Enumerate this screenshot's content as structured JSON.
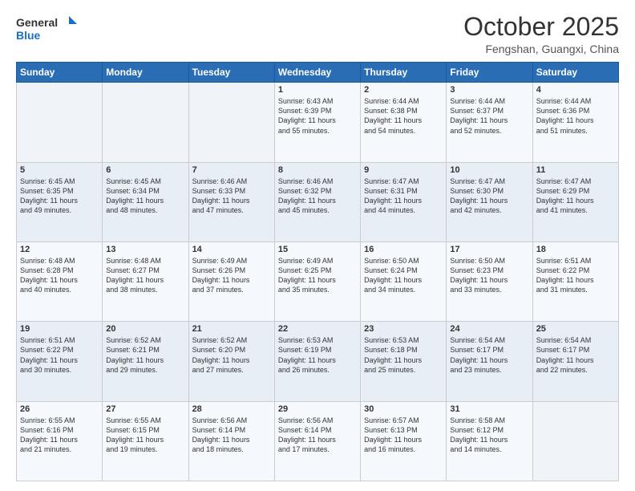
{
  "logo": {
    "line1": "General",
    "line2": "Blue"
  },
  "title": "October 2025",
  "location": "Fengshan, Guangxi, China",
  "weekdays": [
    "Sunday",
    "Monday",
    "Tuesday",
    "Wednesday",
    "Thursday",
    "Friday",
    "Saturday"
  ],
  "weeks": [
    [
      {
        "day": "",
        "info": ""
      },
      {
        "day": "",
        "info": ""
      },
      {
        "day": "",
        "info": ""
      },
      {
        "day": "1",
        "info": "Sunrise: 6:43 AM\nSunset: 6:39 PM\nDaylight: 11 hours\nand 55 minutes."
      },
      {
        "day": "2",
        "info": "Sunrise: 6:44 AM\nSunset: 6:38 PM\nDaylight: 11 hours\nand 54 minutes."
      },
      {
        "day": "3",
        "info": "Sunrise: 6:44 AM\nSunset: 6:37 PM\nDaylight: 11 hours\nand 52 minutes."
      },
      {
        "day": "4",
        "info": "Sunrise: 6:44 AM\nSunset: 6:36 PM\nDaylight: 11 hours\nand 51 minutes."
      }
    ],
    [
      {
        "day": "5",
        "info": "Sunrise: 6:45 AM\nSunset: 6:35 PM\nDaylight: 11 hours\nand 49 minutes."
      },
      {
        "day": "6",
        "info": "Sunrise: 6:45 AM\nSunset: 6:34 PM\nDaylight: 11 hours\nand 48 minutes."
      },
      {
        "day": "7",
        "info": "Sunrise: 6:46 AM\nSunset: 6:33 PM\nDaylight: 11 hours\nand 47 minutes."
      },
      {
        "day": "8",
        "info": "Sunrise: 6:46 AM\nSunset: 6:32 PM\nDaylight: 11 hours\nand 45 minutes."
      },
      {
        "day": "9",
        "info": "Sunrise: 6:47 AM\nSunset: 6:31 PM\nDaylight: 11 hours\nand 44 minutes."
      },
      {
        "day": "10",
        "info": "Sunrise: 6:47 AM\nSunset: 6:30 PM\nDaylight: 11 hours\nand 42 minutes."
      },
      {
        "day": "11",
        "info": "Sunrise: 6:47 AM\nSunset: 6:29 PM\nDaylight: 11 hours\nand 41 minutes."
      }
    ],
    [
      {
        "day": "12",
        "info": "Sunrise: 6:48 AM\nSunset: 6:28 PM\nDaylight: 11 hours\nand 40 minutes."
      },
      {
        "day": "13",
        "info": "Sunrise: 6:48 AM\nSunset: 6:27 PM\nDaylight: 11 hours\nand 38 minutes."
      },
      {
        "day": "14",
        "info": "Sunrise: 6:49 AM\nSunset: 6:26 PM\nDaylight: 11 hours\nand 37 minutes."
      },
      {
        "day": "15",
        "info": "Sunrise: 6:49 AM\nSunset: 6:25 PM\nDaylight: 11 hours\nand 35 minutes."
      },
      {
        "day": "16",
        "info": "Sunrise: 6:50 AM\nSunset: 6:24 PM\nDaylight: 11 hours\nand 34 minutes."
      },
      {
        "day": "17",
        "info": "Sunrise: 6:50 AM\nSunset: 6:23 PM\nDaylight: 11 hours\nand 33 minutes."
      },
      {
        "day": "18",
        "info": "Sunrise: 6:51 AM\nSunset: 6:22 PM\nDaylight: 11 hours\nand 31 minutes."
      }
    ],
    [
      {
        "day": "19",
        "info": "Sunrise: 6:51 AM\nSunset: 6:22 PM\nDaylight: 11 hours\nand 30 minutes."
      },
      {
        "day": "20",
        "info": "Sunrise: 6:52 AM\nSunset: 6:21 PM\nDaylight: 11 hours\nand 29 minutes."
      },
      {
        "day": "21",
        "info": "Sunrise: 6:52 AM\nSunset: 6:20 PM\nDaylight: 11 hours\nand 27 minutes."
      },
      {
        "day": "22",
        "info": "Sunrise: 6:53 AM\nSunset: 6:19 PM\nDaylight: 11 hours\nand 26 minutes."
      },
      {
        "day": "23",
        "info": "Sunrise: 6:53 AM\nSunset: 6:18 PM\nDaylight: 11 hours\nand 25 minutes."
      },
      {
        "day": "24",
        "info": "Sunrise: 6:54 AM\nSunset: 6:17 PM\nDaylight: 11 hours\nand 23 minutes."
      },
      {
        "day": "25",
        "info": "Sunrise: 6:54 AM\nSunset: 6:17 PM\nDaylight: 11 hours\nand 22 minutes."
      }
    ],
    [
      {
        "day": "26",
        "info": "Sunrise: 6:55 AM\nSunset: 6:16 PM\nDaylight: 11 hours\nand 21 minutes."
      },
      {
        "day": "27",
        "info": "Sunrise: 6:55 AM\nSunset: 6:15 PM\nDaylight: 11 hours\nand 19 minutes."
      },
      {
        "day": "28",
        "info": "Sunrise: 6:56 AM\nSunset: 6:14 PM\nDaylight: 11 hours\nand 18 minutes."
      },
      {
        "day": "29",
        "info": "Sunrise: 6:56 AM\nSunset: 6:14 PM\nDaylight: 11 hours\nand 17 minutes."
      },
      {
        "day": "30",
        "info": "Sunrise: 6:57 AM\nSunset: 6:13 PM\nDaylight: 11 hours\nand 16 minutes."
      },
      {
        "day": "31",
        "info": "Sunrise: 6:58 AM\nSunset: 6:12 PM\nDaylight: 11 hours\nand 14 minutes."
      },
      {
        "day": "",
        "info": ""
      }
    ]
  ]
}
